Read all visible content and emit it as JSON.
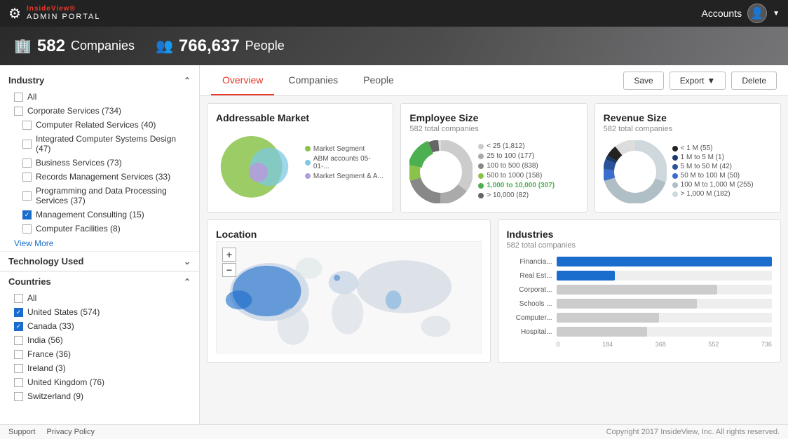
{
  "header": {
    "brand_insideview": "InsideView®",
    "brand_portal": "ADMIN PORTAL",
    "accounts_label": "Accounts"
  },
  "hero": {
    "companies_count": "582",
    "companies_label": "Companies",
    "people_count": "766,637",
    "people_label": "People"
  },
  "tabs": {
    "overview": "Overview",
    "companies": "Companies",
    "people": "People",
    "save": "Save",
    "export": "Export",
    "delete": "Delete"
  },
  "sidebar": {
    "industry_label": "Industry",
    "all_label": "All",
    "corporate_services": "Corporate Services (734)",
    "computer_related": "Computer Related Services (40)",
    "integrated_computer": "Integrated Computer Systems Design (47)",
    "business_services": "Business Services (73)",
    "records_management": "Records Management Services (33)",
    "programming": "Programming and Data Processing Services (37)",
    "management_consulting": "Management Consulting (15)",
    "computer_facilities": "Computer Facilities (8)",
    "view_more": "View More",
    "technology_used": "Technology Used",
    "countries_label": "Countries",
    "country_all": "All",
    "united_states": "United States (574)",
    "canada": "Canada (33)",
    "india": "India (56)",
    "france": "France (36)",
    "ireland": "Ireland (3)",
    "united_kingdom": "United Kingdom (76)",
    "switzerland": "Switzerland (9)"
  },
  "addressable_market": {
    "title": "Addressable Market",
    "legend": {
      "market_segment": "Market Segment",
      "abm_accounts": "ABM accounts 05-01-...",
      "market_segment_a": "Market Segment & A..."
    },
    "colors": {
      "green": "#8bc34a",
      "blue": "#7ec8e3",
      "purple": "#b39ddb"
    }
  },
  "employee_size": {
    "title": "Employee Size",
    "subtitle": "582 total companies",
    "entries": [
      {
        "label": "< 25 (1,812)",
        "color": "#ccc",
        "pct": 0.35
      },
      {
        "label": "25 to 100 (177)",
        "color": "#aaa",
        "pct": 0.15
      },
      {
        "label": "100 to 500 (838)",
        "color": "#888",
        "pct": 0.2
      },
      {
        "label": "500 to 1000 (158)",
        "color": "#8bc34a",
        "pct": 0.08
      },
      {
        "label": "1,000 to 10,000 (307)",
        "color": "#4caf50",
        "pct": 0.15,
        "bold": true
      },
      {
        "label": "> 10,000 (82)",
        "color": "#666",
        "pct": 0.05
      }
    ]
  },
  "revenue_size": {
    "title": "Revenue Size",
    "subtitle": "582 total companies",
    "entries": [
      {
        "label": "< 1 M (55)",
        "color": "#222",
        "pct": 0.06
      },
      {
        "label": "1 M to 5 M (1)",
        "color": "#1a3a6b",
        "pct": 0.02
      },
      {
        "label": "5 M to 50 M (42)",
        "color": "#2a5298",
        "pct": 0.05
      },
      {
        "label": "50 M to 100 M (50)",
        "color": "#3a6dcc",
        "pct": 0.06
      },
      {
        "label": "100 M to 1,000 M (255)",
        "color": "#b0bec5",
        "pct": 0.4
      },
      {
        "label": "> 1,000 M (182)",
        "color": "#cfd8dc",
        "pct": 0.3
      }
    ]
  },
  "location": {
    "title": "Location"
  },
  "industries": {
    "title": "Industries",
    "subtitle": "582 total companies",
    "bars": [
      {
        "label": "Financia...",
        "value": 736,
        "max": 736,
        "color": "#1a6dcc"
      },
      {
        "label": "Real Est...",
        "value": 200,
        "max": 736,
        "color": "#1a6dcc"
      },
      {
        "label": "Corporat...",
        "value": 550,
        "max": 736,
        "color": "#ccc"
      },
      {
        "label": "Schools ...",
        "value": 480,
        "max": 736,
        "color": "#ccc"
      },
      {
        "label": "Computer...",
        "value": 350,
        "max": 736,
        "color": "#ccc"
      },
      {
        "label": "Hospital...",
        "value": 310,
        "max": 736,
        "color": "#ccc"
      }
    ],
    "axis": [
      "0",
      "184",
      "368",
      "552",
      "736"
    ]
  },
  "footer": {
    "support": "Support",
    "privacy": "Privacy Policy",
    "copyright": "Copyright 2017 InsideView, Inc. All rights reserved."
  }
}
